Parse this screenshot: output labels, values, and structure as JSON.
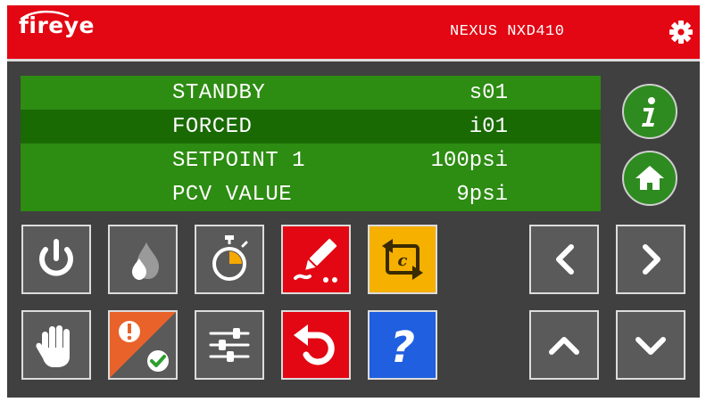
{
  "header": {
    "brand": "fireye",
    "model": "NEXUS NXD410",
    "settings_icon": "gear-icon"
  },
  "display": {
    "rows": [
      {
        "label": "STANDBY",
        "value": "s01",
        "highlighted": false
      },
      {
        "label": "FORCED",
        "value": "i01",
        "highlighted": true
      },
      {
        "label": "SETPOINT 1",
        "value": "100psi",
        "highlighted": false
      },
      {
        "label": "PCV VALUE",
        "value": "9psi",
        "highlighted": false
      }
    ]
  },
  "side_buttons": {
    "info_icon": "info-icon",
    "home_icon": "home-icon"
  },
  "keypad": {
    "row1": [
      "power-icon",
      "flame-icon",
      "timer-icon",
      "edit-icon",
      "cycle-c-icon"
    ],
    "row2": [
      "hand-icon",
      "alarm-ack-icon",
      "sliders-icon",
      "undo-icon",
      "help-icon"
    ],
    "help_glyph": "?",
    "cycle_glyph": "c"
  },
  "nav": {
    "icons": [
      "chevron-left-icon",
      "chevron-right-icon",
      "chevron-up-icon",
      "chevron-down-icon"
    ]
  },
  "colors": {
    "header_red": "#e30613",
    "panel_gray": "#404040",
    "lcd_green": "#2d8c12",
    "lcd_highlight": "#1a6a04",
    "key_gray": "#5a5a5a",
    "key_red": "#e30613",
    "key_yellow": "#f5b000",
    "key_blue": "#1f5fe0",
    "key_orange": "#e8622a",
    "timer_accent": "#f5a800",
    "round_green": "#2e8b20"
  }
}
